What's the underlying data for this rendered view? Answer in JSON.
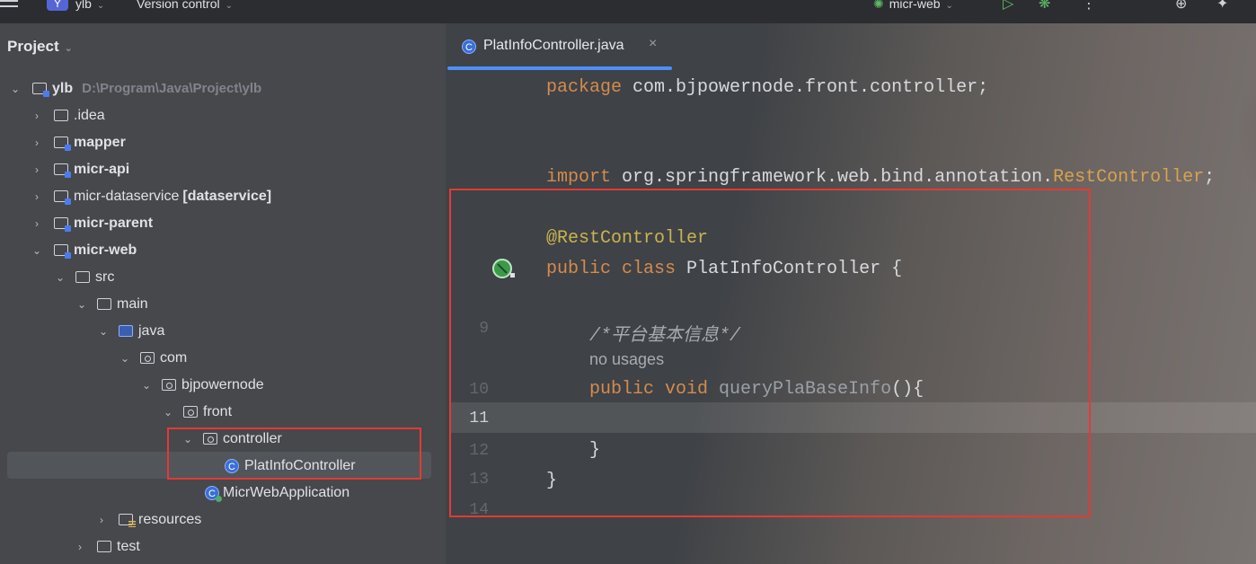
{
  "toolbar": {
    "project_badge": "Y",
    "project_name": "ylb",
    "vcs_label": "Version control",
    "run_config": "micr-web"
  },
  "project_panel": {
    "title": "Project",
    "tree": [
      {
        "label": "ylb",
        "path": "D:\\Program\\Java\\Project\\ylb"
      },
      {
        "label": ".idea"
      },
      {
        "label": "mapper"
      },
      {
        "label": "micr-api"
      },
      {
        "label": "micr-dataservice",
        "suffix": "[dataservice]"
      },
      {
        "label": "micr-parent"
      },
      {
        "label": "micr-web"
      },
      {
        "label": "src"
      },
      {
        "label": "main"
      },
      {
        "label": "java"
      },
      {
        "label": "com"
      },
      {
        "label": "bjpowernode"
      },
      {
        "label": "front"
      },
      {
        "label": "controller"
      },
      {
        "label": "PlatInfoController"
      },
      {
        "label": "MicrWebApplication"
      },
      {
        "label": "resources"
      },
      {
        "label": "test"
      }
    ]
  },
  "editor": {
    "tab": {
      "icon": "C",
      "title": "PlatInfoController.java"
    },
    "line_numbers": [
      "9",
      "10",
      "11",
      "12",
      "13",
      "14"
    ],
    "code": {
      "package_kw": "package",
      "package_name": " com.bjpowernode.front.controller;",
      "import_kw": "import",
      "import_path": " org.springframework.web.bind.annotation.",
      "import_class": "RestController",
      "import_end": ";",
      "annotation": "@RestController",
      "class_kw": "public class",
      "class_name": " PlatInfoController {",
      "comment": "/*平台基本信息*/",
      "usage_hint": "no usages",
      "method_kw": "public void",
      "method_name": " queryPlaBaseInfo",
      "method_end": "(){",
      "close_method": "}",
      "close_class": "}"
    }
  }
}
